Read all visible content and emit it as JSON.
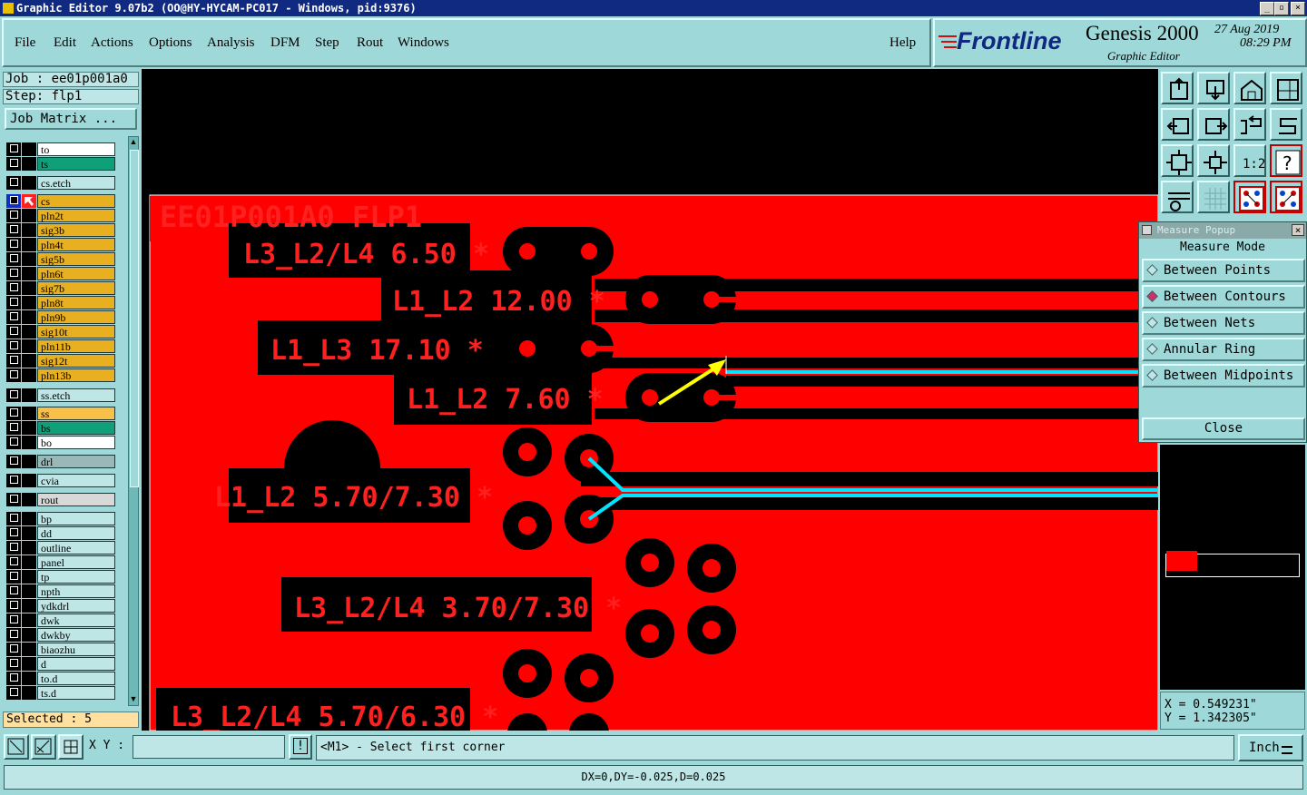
{
  "window": {
    "title": "Graphic Editor 9.07b2 (OO@HY-HYCAM-PC017 - Windows, pid:9376)"
  },
  "menu": {
    "items": [
      "File",
      "Edit",
      "Actions",
      "Options",
      "Analysis",
      "DFM",
      "Step",
      "Rout",
      "Windows"
    ],
    "help": "Help"
  },
  "brand": {
    "logo": "Frontline",
    "product": "Genesis 2000",
    "subtitle": "Graphic Editor",
    "date": "27 Aug 2019",
    "time": "08:29 PM"
  },
  "job": {
    "job_line": "Job : ee01p001a0",
    "step_line": "Step: flp1",
    "matrix_button": "Job Matrix ..."
  },
  "layers": [
    {
      "name": "to",
      "color": "#ffffff"
    },
    {
      "name": "ts",
      "color": "#0fa07a"
    },
    {
      "name": "cs.etch",
      "color": "#bfe6e6"
    },
    {
      "name": "cs",
      "color": "#e8b020",
      "active": true
    },
    {
      "name": "pln2t",
      "color": "#e8b020"
    },
    {
      "name": "sig3b",
      "color": "#e8b020"
    },
    {
      "name": "pln4t",
      "color": "#e8b020"
    },
    {
      "name": "sig5b",
      "color": "#e8b020"
    },
    {
      "name": "pln6t",
      "color": "#e8b020"
    },
    {
      "name": "sig7b",
      "color": "#e8b020"
    },
    {
      "name": "pln8t",
      "color": "#e8b020"
    },
    {
      "name": "pln9b",
      "color": "#e8b020"
    },
    {
      "name": "sig10t",
      "color": "#e8b020"
    },
    {
      "name": "pln11b",
      "color": "#e8b020"
    },
    {
      "name": "sig12t",
      "color": "#e8b020"
    },
    {
      "name": "pln13b",
      "color": "#e8b020"
    },
    {
      "name": "ss.etch",
      "color": "#bfe6e6"
    },
    {
      "name": "ss",
      "color": "#f8c048"
    },
    {
      "name": "bs",
      "color": "#0fa07a"
    },
    {
      "name": "bo",
      "color": "#ffffff"
    },
    {
      "name": "drl",
      "color": "#9ab8b8"
    },
    {
      "name": "cvia",
      "color": "#bfe6e6"
    },
    {
      "name": "rout",
      "color": "#d8d8d8"
    },
    {
      "name": "bp",
      "color": "#bfe6e6"
    },
    {
      "name": "dd",
      "color": "#bfe6e6"
    },
    {
      "name": "outline",
      "color": "#bfe6e6"
    },
    {
      "name": "panel",
      "color": "#bfe6e6"
    },
    {
      "name": "tp",
      "color": "#bfe6e6"
    },
    {
      "name": "npth",
      "color": "#bfe6e6"
    },
    {
      "name": "ydkdrl",
      "color": "#bfe6e6"
    },
    {
      "name": "dwk",
      "color": "#bfe6e6"
    },
    {
      "name": "dwkby",
      "color": "#bfe6e6"
    },
    {
      "name": "biaozhu",
      "color": "#bfe6e6"
    },
    {
      "name": "d",
      "color": "#bfe6e6"
    },
    {
      "name": "to.d",
      "color": "#bfe6e6"
    },
    {
      "name": "ts.d",
      "color": "#bfe6e6"
    }
  ],
  "selected_text": "Selected : 5",
  "canvas": {
    "board_title": "EE01P001A0 FLP1",
    "labels": [
      "L3_L2/L4 6.50 *",
      "L1_L2 12.00 *",
      "L1_L3 17.10 *",
      "L1_L2 7.60 *",
      "L1_L2 5.70/7.30 *",
      "L3_L2/L4 3.70/7.30 *",
      "L3_L2/L4 5.70/6.30 *"
    ],
    "board_color": "#ff0000",
    "highlight_color": "#00e5ff",
    "arrow_color": "#ffff00"
  },
  "measure_popup": {
    "title": "Measure Popup",
    "mode_label": "Measure Mode",
    "options": [
      "Between Points",
      "Between Contours",
      "Between Nets",
      "Annular Ring",
      "Between Midpoints"
    ],
    "selected": "Between Contours",
    "close_label": "Close"
  },
  "tools": {
    "zoom_ratio_label": "1:2",
    "help_label": "?"
  },
  "coords": {
    "x": "X = 0.549231\"",
    "y": "Y = 1.342305\""
  },
  "bottom": {
    "xy_label": "X Y :",
    "xy_value": "",
    "info_label": "!",
    "prompt": "<M1> - Select first corner",
    "units": "Inch",
    "status": "DX=0,DY=-0.025,D=0.025"
  }
}
